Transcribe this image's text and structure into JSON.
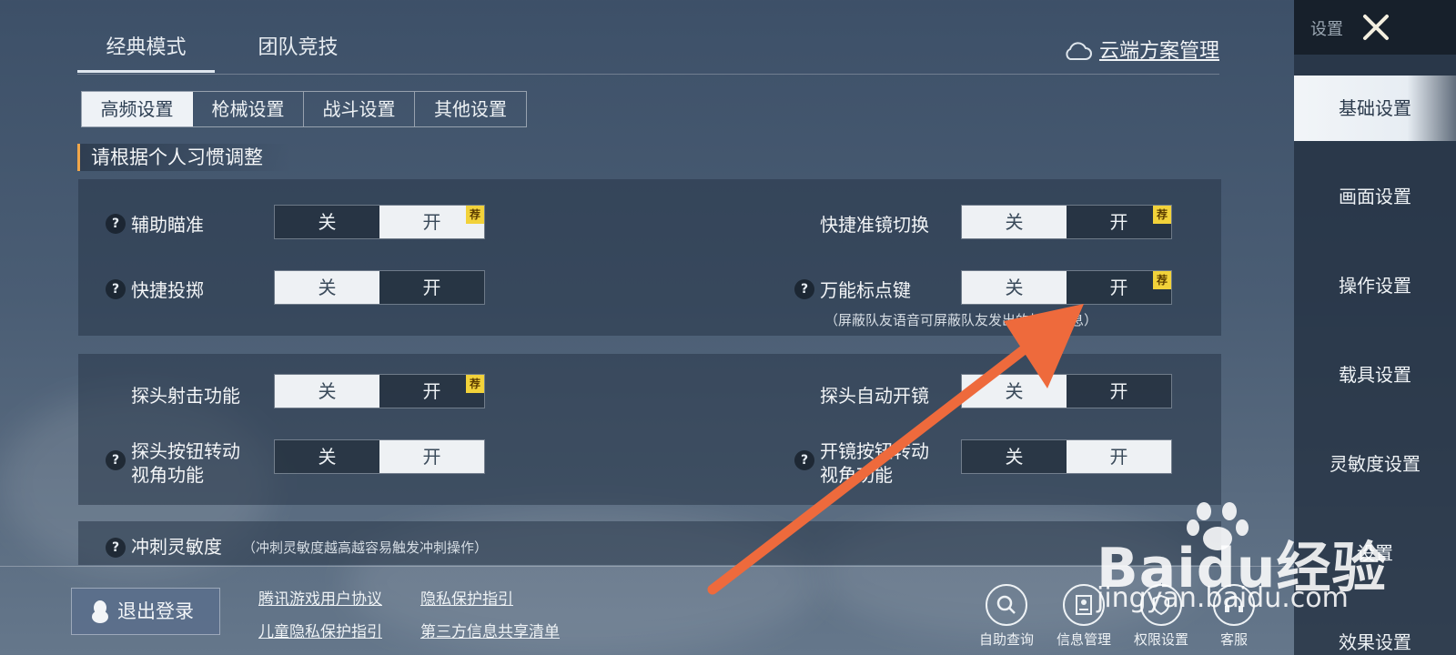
{
  "top_tabs": [
    {
      "label": "经典模式",
      "active": true
    },
    {
      "label": "团队竞技",
      "active": false
    }
  ],
  "cloud_link": "云端方案管理",
  "sub_tabs": [
    {
      "label": "高频设置",
      "active": true
    },
    {
      "label": "枪械设置",
      "active": false
    },
    {
      "label": "战斗设置",
      "active": false
    },
    {
      "label": "其他设置",
      "active": false
    }
  ],
  "section_heading": "请根据个人习惯调整",
  "option_labels": {
    "off": "关",
    "on": "开"
  },
  "recommend_tag": "荐",
  "panel1": {
    "aim_assist": {
      "label": "辅助瞄准",
      "value": "on",
      "recommended": true
    },
    "quick_scope_switch": {
      "label": "快捷准镜切换",
      "value": "off",
      "recommended": true
    },
    "quick_throw": {
      "label": "快捷投掷",
      "value": "off"
    },
    "universal_marker": {
      "label": "万能标点键",
      "value": "off",
      "recommended": true
    },
    "marker_note": "（屏蔽队友语音可屏蔽队友发出的标点信息）"
  },
  "panel2": {
    "peek_fire": {
      "label": "探头射击功能",
      "value": "off",
      "recommended": true
    },
    "peek_auto_scope": {
      "label": "探头自动开镜",
      "value": "off"
    },
    "peek_button_rotate": {
      "label": "探头按钮转动视角功能",
      "value": "on"
    },
    "scope_button_rotate": {
      "label": "开镜按钮转动视角功能",
      "value": "on"
    }
  },
  "panel3": {
    "sprint_sensitivity": {
      "label": "冲刺灵敏度",
      "note": "（冲刺灵敏度越高越容易触发冲刺操作）"
    }
  },
  "sidebar": {
    "header": "设置",
    "items": [
      {
        "label": "基础设置",
        "active": true
      },
      {
        "label": "画面设置",
        "active": false
      },
      {
        "label": "操作设置",
        "active": false
      },
      {
        "label": "载具设置",
        "active": false
      },
      {
        "label": "灵敏度设置",
        "active": false
      },
      {
        "label": "设置",
        "active": false
      },
      {
        "label": "效果设置",
        "active": false
      }
    ]
  },
  "bottom": {
    "logout": "退出登录",
    "links": [
      "腾讯游戏用户协议",
      "隐私保护指引",
      "儿童隐私保护指引",
      "第三方信息共享清单"
    ],
    "icons": [
      {
        "label": "自助查询",
        "icon": "search-icon"
      },
      {
        "label": "信息管理",
        "icon": "id-card-icon"
      },
      {
        "label": "权限设置",
        "icon": "shield-icon"
      },
      {
        "label": "客服",
        "icon": "headset-icon"
      }
    ]
  },
  "watermark": {
    "brand": "Baidu经验",
    "url": "jingyan.baidu.com"
  },
  "colors": {
    "accent_bar": "#f0a64a",
    "tag": "#f2d23a",
    "arrow": "#ee6a3c"
  }
}
